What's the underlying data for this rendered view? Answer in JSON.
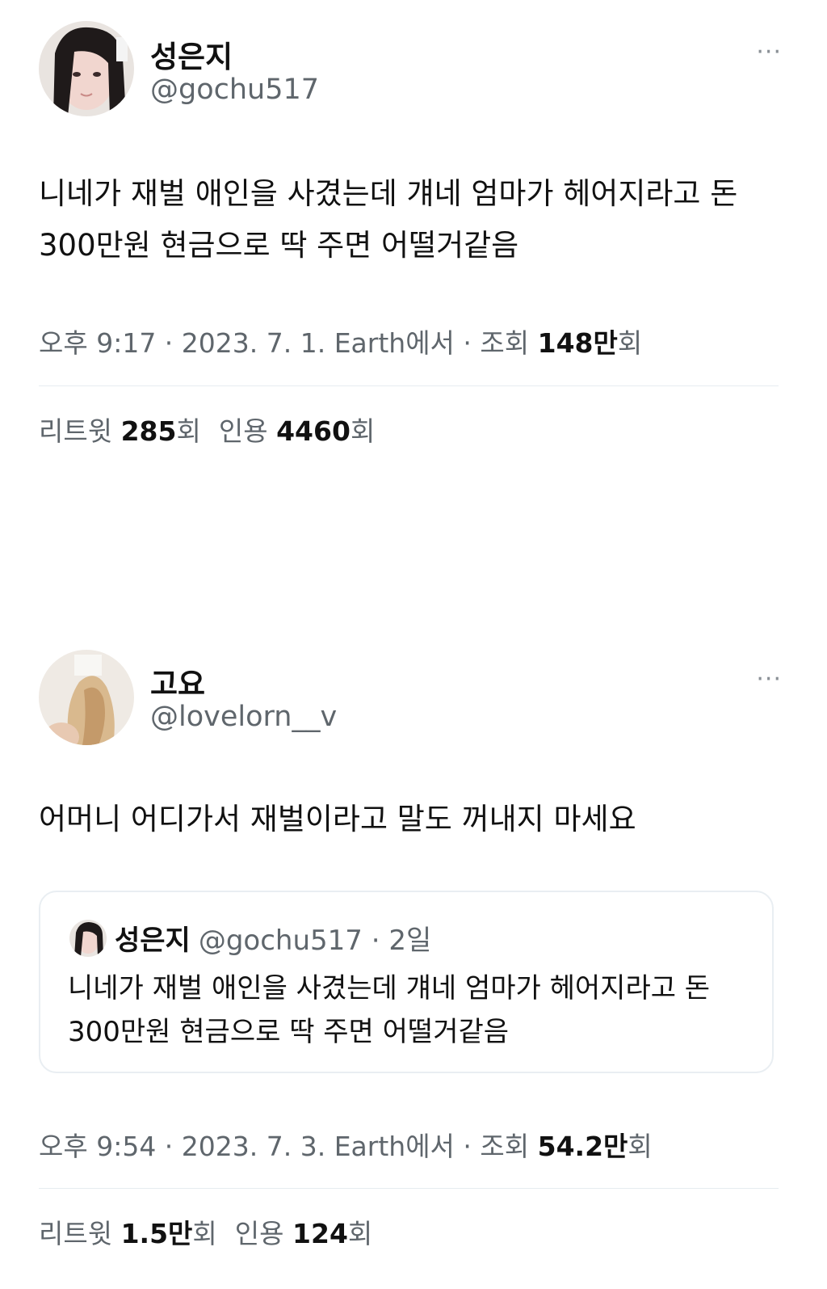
{
  "tweets": [
    {
      "name": "성은지",
      "handle": "@gochu517",
      "more_icon": "···",
      "text": "니네가 재벌 애인을 사겼는데 걔네 엄마가 헤어지라고 돈 300만원 현금으로 딱 주면 어떨거같음",
      "meta_prefix": "오후 9:17 · 2023. 7. 1. Earth에서 · 조회",
      "views_number": "148만",
      "views_suffix": "회",
      "retweets_label": "리트윗",
      "retweets_number": "285",
      "retweets_suffix": "회",
      "quotes_label": "인용",
      "quotes_number": "4460",
      "quotes_suffix": "회"
    },
    {
      "name": "고요",
      "handle": "@lovelorn__v",
      "more_icon": "···",
      "text": "어머니 어디가서 재벌이라고 말도 꺼내지 마세요",
      "quote": {
        "name": "성은지",
        "handle_time": "@gochu517 · 2일",
        "text": "니네가 재벌 애인을 사겼는데 걔네 엄마가 헤어지라고 돈 300만원 현금으로 딱 주면 어떨거같음"
      },
      "meta_prefix": "오후 9:54 · 2023. 7. 3. Earth에서 · 조회",
      "views_number": "54.2만",
      "views_suffix": "회",
      "retweets_label": "리트윗",
      "retweets_number": "1.5만",
      "retweets_suffix": "회",
      "quotes_label": "인용",
      "quotes_number": "124",
      "quotes_suffix": "회"
    }
  ],
  "colors": {
    "text": "#111111",
    "secondary": "#5f666c",
    "divider": "#e6ecf0"
  }
}
